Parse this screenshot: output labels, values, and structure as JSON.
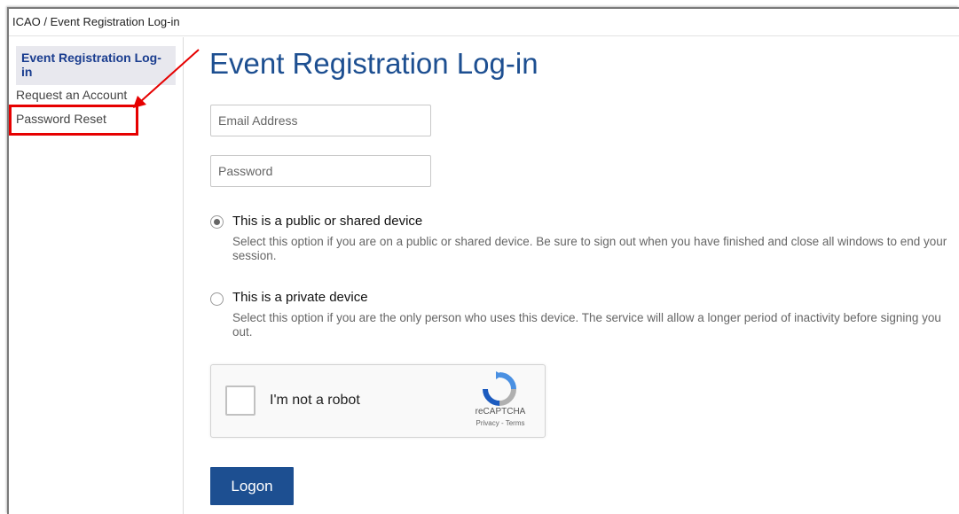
{
  "breadcrumb": "ICAO / Event Registration Log-in",
  "sidebar": {
    "items": [
      {
        "label": "Event Registration Log-in",
        "active": true
      },
      {
        "label": "Request an Account"
      },
      {
        "label": "Password Reset",
        "highlighted": true
      }
    ]
  },
  "main": {
    "title": "Event Registration Log-in",
    "email": {
      "placeholder": "Email Address",
      "value": ""
    },
    "password": {
      "placeholder": "Password",
      "value": ""
    },
    "options": [
      {
        "title": "This is a public or shared device",
        "description": "Select this option if you are on a public or shared device. Be sure to sign out when you have finished and close all windows to end your session.",
        "selected": true
      },
      {
        "title": "This is a private device",
        "description": "Select this option if you are the only person who uses this device. The service will allow a longer period of inactivity before signing you out.",
        "selected": false
      }
    ],
    "captcha": {
      "label": "I'm not a robot",
      "brand": "reCAPTCHA",
      "terms": "Privacy - Terms"
    },
    "logon_label": "Logon"
  },
  "colors": {
    "accent": "#1d4f91",
    "annotation": "#e60000",
    "sidebar_active_bg": "#e8e8ee"
  }
}
